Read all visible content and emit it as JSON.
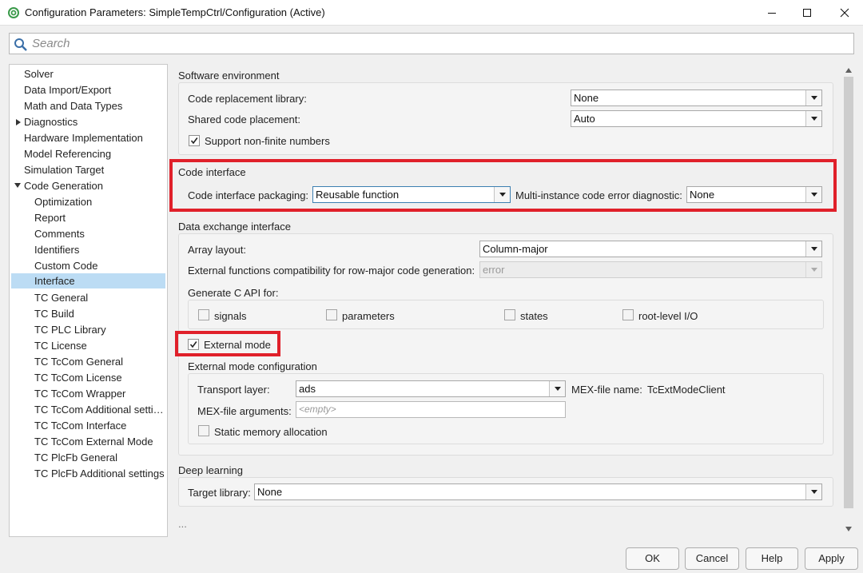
{
  "window": {
    "title": "Configuration Parameters: SimpleTempCtrl/Configuration (Active)",
    "app_icon": "simulink-gear-icon",
    "controls": [
      "minimize-icon",
      "maximize-icon",
      "close-icon"
    ]
  },
  "search": {
    "placeholder": "Search",
    "icon": "search-icon"
  },
  "sidebar": {
    "items": [
      {
        "label": "Solver"
      },
      {
        "label": "Data Import/Export"
      },
      {
        "label": "Math and Data Types"
      },
      {
        "label": "Diagnostics",
        "expander": "collapsed"
      },
      {
        "label": "Hardware Implementation"
      },
      {
        "label": "Model Referencing"
      },
      {
        "label": "Simulation Target"
      },
      {
        "label": "Code Generation",
        "expander": "expanded"
      },
      {
        "label": "Optimization"
      },
      {
        "label": "Report"
      },
      {
        "label": "Comments"
      },
      {
        "label": "Identifiers"
      },
      {
        "label": "Custom Code"
      },
      {
        "label": "Interface",
        "selected": true
      },
      {
        "label": "TC General"
      },
      {
        "label": "TC Build"
      },
      {
        "label": "TC PLC Library"
      },
      {
        "label": "TC License"
      },
      {
        "label": "TC TcCom General"
      },
      {
        "label": "TC TcCom License"
      },
      {
        "label": "TC TcCom Wrapper"
      },
      {
        "label": "TC TcCom Additional setti…"
      },
      {
        "label": "TC TcCom Interface"
      },
      {
        "label": "TC TcCom External Mode"
      },
      {
        "label": "TC PlcFb General"
      },
      {
        "label": "TC PlcFb Additional settings"
      }
    ]
  },
  "software_env": {
    "title": "Software environment",
    "code_replacement_label": "Code replacement library:",
    "code_replacement_value": "None",
    "shared_code_label": "Shared code placement:",
    "shared_code_value": "Auto",
    "non_finite_label": "Support non-finite numbers",
    "non_finite_checked": true
  },
  "code_interface": {
    "title": "Code interface",
    "packaging_label": "Code interface packaging:",
    "packaging_value": "Reusable function",
    "multi_instance_label": "Multi-instance code error diagnostic:",
    "multi_instance_value": "None"
  },
  "data_exchange": {
    "title": "Data exchange interface",
    "array_layout_label": "Array layout:",
    "array_layout_value": "Column-major",
    "ext_func_label": "External functions compatibility for row-major code generation:",
    "ext_func_value": "error",
    "gen_c_api_label": "Generate C API for:",
    "c_api": {
      "signals": "signals",
      "parameters": "parameters",
      "states": "states",
      "root_io": "root-level I/O"
    },
    "external_mode_label": "External mode",
    "external_mode_checked": true,
    "ext_mode_config_title": "External mode configuration",
    "transport_label": "Transport layer:",
    "transport_value": "ads",
    "mex_name_label": "MEX-file name:",
    "mex_name_value": "TcExtModeClient",
    "mex_args_label": "MEX-file arguments:",
    "mex_args_placeholder": "<empty>",
    "static_mem_label": "Static memory allocation",
    "static_mem_checked": false
  },
  "deep_learning": {
    "title": "Deep learning",
    "target_label": "Target library:",
    "target_value": "None"
  },
  "more": "...",
  "footer": {
    "ok": "OK",
    "cancel": "Cancel",
    "help": "Help",
    "apply": "Apply"
  },
  "colors": {
    "highlight": "#e0202a",
    "selected": "#bcdcf4"
  }
}
